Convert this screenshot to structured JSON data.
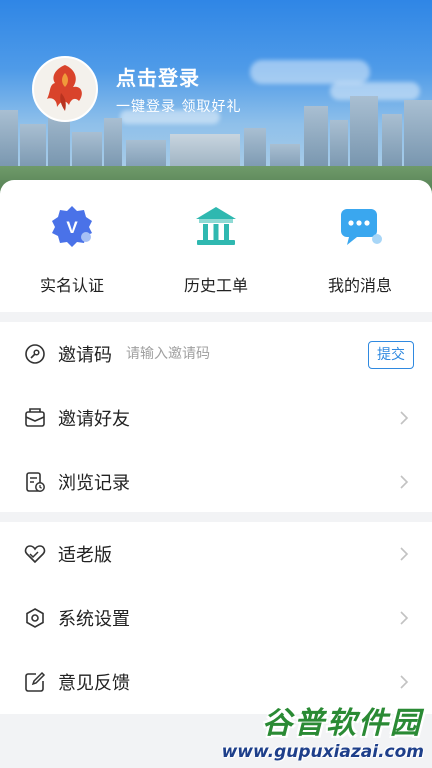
{
  "header": {
    "login_title": "点击登录",
    "login_subtitle": "一键登录 领取好礼"
  },
  "quick_actions": [
    {
      "label": "实名认证",
      "icon": "verified-badge-icon",
      "color": "#4a72e8"
    },
    {
      "label": "历史工单",
      "icon": "building-icon",
      "color": "#2fb8b0"
    },
    {
      "label": "我的消息",
      "icon": "message-bubble-icon",
      "color": "#3aa7ef"
    }
  ],
  "invite": {
    "label": "邀请码",
    "placeholder": "请输入邀请码",
    "submit_label": "提交"
  },
  "menu_group_1": [
    {
      "label": "邀请好友",
      "icon": "envelope-icon"
    },
    {
      "label": "浏览记录",
      "icon": "history-doc-icon"
    }
  ],
  "menu_group_2": [
    {
      "label": "适老版",
      "icon": "heart-hands-icon"
    },
    {
      "label": "系统设置",
      "icon": "gear-hexagon-icon"
    },
    {
      "label": "意见反馈",
      "icon": "edit-icon"
    }
  ],
  "watermark": {
    "name": "谷普软件园",
    "url": "www.gupuxiazai.com"
  },
  "colors": {
    "accent": "#2f89e0",
    "hero_top": "#2f86e6"
  }
}
